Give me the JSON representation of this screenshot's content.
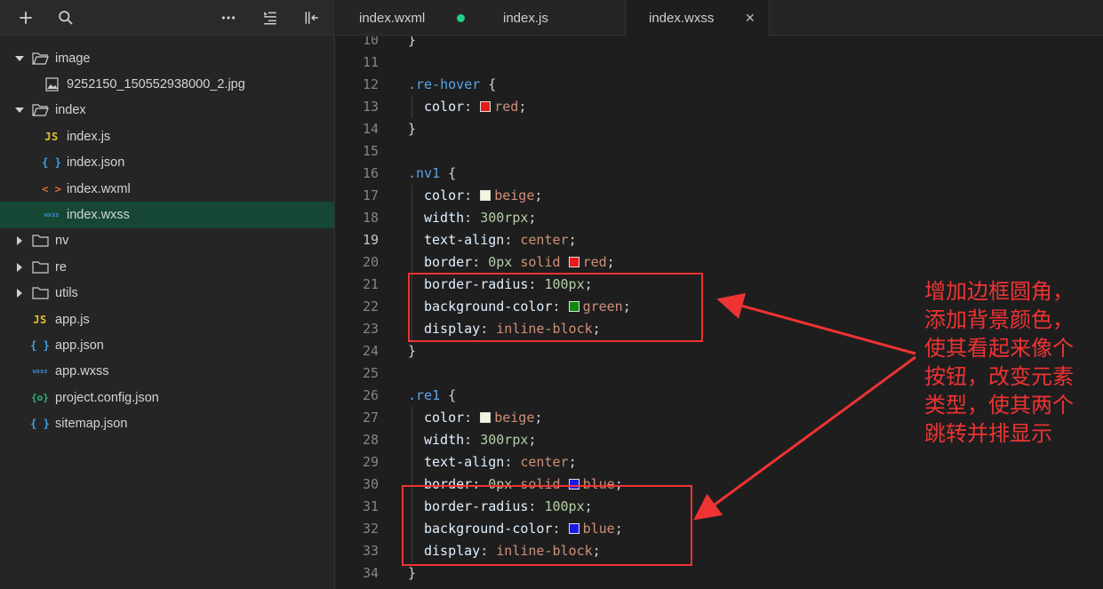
{
  "toolbar": {
    "icons": [
      "plus-icon",
      "search-icon",
      "more-icon",
      "outline-icon",
      "collapse-icon"
    ]
  },
  "tree": [
    {
      "name": "image",
      "type": "folder",
      "open": true,
      "depth": 0
    },
    {
      "name": "9252150_150552938000_2.jpg",
      "type": "image",
      "depth": 1
    },
    {
      "name": "index",
      "type": "folder",
      "open": true,
      "depth": 0
    },
    {
      "name": "index.js",
      "type": "js",
      "icon": "JS",
      "depth": 1
    },
    {
      "name": "index.json",
      "type": "json",
      "icon": "{ }",
      "depth": 1
    },
    {
      "name": "index.wxml",
      "type": "wxml",
      "icon": "< >",
      "depth": 1
    },
    {
      "name": "index.wxss",
      "type": "wxss",
      "icon": "wxss",
      "depth": 1,
      "selected": true
    },
    {
      "name": "nv",
      "type": "folder",
      "open": false,
      "depth": 0
    },
    {
      "name": "re",
      "type": "folder",
      "open": false,
      "depth": 0
    },
    {
      "name": "utils",
      "type": "folder",
      "open": false,
      "depth": 0
    },
    {
      "name": "app.js",
      "type": "js",
      "icon": "JS",
      "depth": 0
    },
    {
      "name": "app.json",
      "type": "json",
      "icon": "{ }",
      "depth": 0
    },
    {
      "name": "app.wxss",
      "type": "wxss",
      "icon": "wxss",
      "depth": 0
    },
    {
      "name": "project.config.json",
      "type": "cfg",
      "icon": "{o}",
      "depth": 0
    },
    {
      "name": "sitemap.json",
      "type": "json",
      "icon": "{ }",
      "depth": 0
    }
  ],
  "tabs": [
    {
      "label": "index.wxml",
      "modified": true,
      "active": false
    },
    {
      "label": "index.js",
      "modified": false,
      "active": false
    },
    {
      "label": "index.wxss",
      "modified": false,
      "active": true,
      "close": "✕"
    }
  ],
  "editor": {
    "current_line": 19,
    "lines": [
      {
        "n": "10",
        "tokens": [
          [
            "punc",
            "}"
          ]
        ]
      },
      {
        "n": "11",
        "tokens": []
      },
      {
        "n": "12",
        "tokens": [
          [
            "sel",
            ".re-hover"
          ],
          [
            "punc",
            " {"
          ]
        ]
      },
      {
        "n": "13",
        "indent": true,
        "tokens": [
          [
            "prop",
            "color"
          ],
          [
            "punc",
            ": "
          ],
          [
            "swatch",
            "#e51a1a"
          ],
          [
            "val",
            "red"
          ],
          [
            "punc",
            ";"
          ]
        ]
      },
      {
        "n": "14",
        "tokens": [
          [
            "punc",
            "}"
          ]
        ]
      },
      {
        "n": "15",
        "tokens": []
      },
      {
        "n": "16",
        "tokens": [
          [
            "sel",
            ".nv1"
          ],
          [
            "punc",
            " {"
          ]
        ]
      },
      {
        "n": "17",
        "indent": true,
        "tokens": [
          [
            "prop",
            "color"
          ],
          [
            "punc",
            ": "
          ],
          [
            "swatch",
            "#f5f5dc"
          ],
          [
            "val",
            "beige"
          ],
          [
            "punc",
            ";"
          ]
        ]
      },
      {
        "n": "18",
        "indent": true,
        "tokens": [
          [
            "prop",
            "width"
          ],
          [
            "punc",
            ": "
          ],
          [
            "num",
            "300rpx"
          ],
          [
            "punc",
            ";"
          ]
        ]
      },
      {
        "n": "19",
        "indent": true,
        "tokens": [
          [
            "prop",
            "text-align"
          ],
          [
            "punc",
            ": "
          ],
          [
            "val",
            "center"
          ],
          [
            "punc",
            ";"
          ]
        ]
      },
      {
        "n": "20",
        "indent": true,
        "tokens": [
          [
            "prop",
            "border"
          ],
          [
            "punc",
            ": "
          ],
          [
            "num",
            "0px"
          ],
          [
            "punc",
            " "
          ],
          [
            "val",
            "solid"
          ],
          [
            "punc",
            " "
          ],
          [
            "swatch",
            "#e51a1a"
          ],
          [
            "val",
            "red"
          ],
          [
            "punc",
            ";"
          ]
        ]
      },
      {
        "n": "21",
        "indent": true,
        "tokens": [
          [
            "prop",
            "border-radius"
          ],
          [
            "punc",
            ": "
          ],
          [
            "num",
            "100px"
          ],
          [
            "punc",
            ";"
          ]
        ]
      },
      {
        "n": "22",
        "indent": true,
        "tokens": [
          [
            "prop",
            "background-color"
          ],
          [
            "punc",
            ": "
          ],
          [
            "swatch",
            "#0a8a0a"
          ],
          [
            "val",
            "green"
          ],
          [
            "punc",
            ";"
          ]
        ]
      },
      {
        "n": "23",
        "indent": true,
        "tokens": [
          [
            "prop",
            "display"
          ],
          [
            "punc",
            ": "
          ],
          [
            "val",
            "inline-block"
          ],
          [
            "punc",
            ";"
          ]
        ]
      },
      {
        "n": "24",
        "tokens": [
          [
            "punc",
            "}"
          ]
        ]
      },
      {
        "n": "25",
        "tokens": []
      },
      {
        "n": "26",
        "tokens": [
          [
            "sel",
            ".re1"
          ],
          [
            "punc",
            " {"
          ]
        ]
      },
      {
        "n": "27",
        "indent": true,
        "tokens": [
          [
            "prop",
            "color"
          ],
          [
            "punc",
            ": "
          ],
          [
            "swatch",
            "#f5f5dc"
          ],
          [
            "val",
            "beige"
          ],
          [
            "punc",
            ";"
          ]
        ]
      },
      {
        "n": "28",
        "indent": true,
        "tokens": [
          [
            "prop",
            "width"
          ],
          [
            "punc",
            ": "
          ],
          [
            "num",
            "300rpx"
          ],
          [
            "punc",
            ";"
          ]
        ]
      },
      {
        "n": "29",
        "indent": true,
        "tokens": [
          [
            "prop",
            "text-align"
          ],
          [
            "punc",
            ": "
          ],
          [
            "val",
            "center"
          ],
          [
            "punc",
            ";"
          ]
        ]
      },
      {
        "n": "30",
        "indent": true,
        "tokens": [
          [
            "prop",
            "border"
          ],
          [
            "punc",
            ": "
          ],
          [
            "num",
            "0px"
          ],
          [
            "punc",
            " "
          ],
          [
            "val",
            "solid"
          ],
          [
            "punc",
            " "
          ],
          [
            "swatch",
            "#1a1ae5"
          ],
          [
            "val",
            "blue"
          ],
          [
            "punc",
            ";"
          ]
        ]
      },
      {
        "n": "31",
        "indent": true,
        "tokens": [
          [
            "prop",
            "border-radius"
          ],
          [
            "punc",
            ": "
          ],
          [
            "num",
            "100px"
          ],
          [
            "punc",
            ";"
          ]
        ]
      },
      {
        "n": "32",
        "indent": true,
        "tokens": [
          [
            "prop",
            "background-color"
          ],
          [
            "punc",
            ": "
          ],
          [
            "swatch",
            "#1a1ae5"
          ],
          [
            "val",
            "blue"
          ],
          [
            "punc",
            ";"
          ]
        ]
      },
      {
        "n": "33",
        "indent": true,
        "tokens": [
          [
            "prop",
            "display"
          ],
          [
            "punc",
            ": "
          ],
          [
            "val",
            "inline-block"
          ],
          [
            "punc",
            ";"
          ]
        ]
      },
      {
        "n": "34",
        "tokens": [
          [
            "punc",
            "}"
          ]
        ]
      }
    ]
  },
  "annotation": {
    "lines": [
      "增加边框圆角，",
      "添加背景颜色，",
      "使其看起来像个",
      "按钮，改变元素",
      "类型，使其两个",
      "跳转并排显示"
    ],
    "color": "#ee3333"
  },
  "colors": {
    "selected_row": "#154734",
    "modified_dot": "#23d18b"
  }
}
